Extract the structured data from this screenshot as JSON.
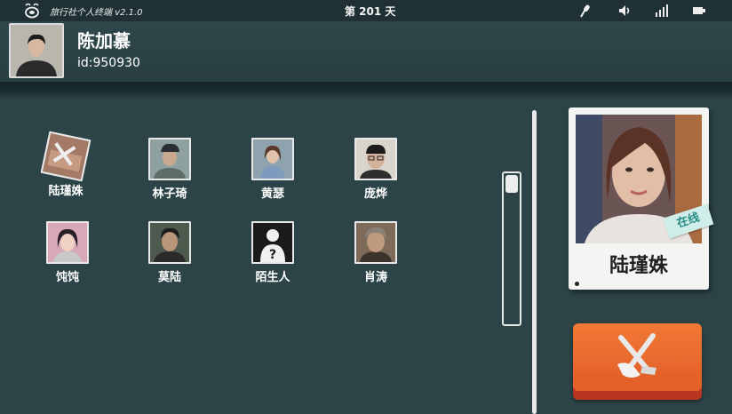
{
  "status_bar": {
    "app_title": "旅行社个人终端 v2.1.0",
    "day_label": "第 201 天",
    "icons": [
      "app-logo-icon",
      "microphone-icon",
      "volume-icon",
      "signal-icon",
      "battery-icon"
    ]
  },
  "user": {
    "name": "陈加慕",
    "id_label": "id:950930"
  },
  "contacts": [
    {
      "name": "陆瑾姝",
      "selected": true
    },
    {
      "name": "林子琦"
    },
    {
      "name": "黄瑟"
    },
    {
      "name": "庞烨"
    },
    {
      "name": "饨饨"
    },
    {
      "name": "莫陆"
    },
    {
      "name": "陌生人"
    },
    {
      "name": "肖涛"
    }
  ],
  "detail": {
    "name": "陆瑾姝",
    "status": "在线"
  },
  "colors": {
    "background": "#2c4448",
    "action_button": "#e4622a",
    "online_tag": "#cfeee9"
  }
}
